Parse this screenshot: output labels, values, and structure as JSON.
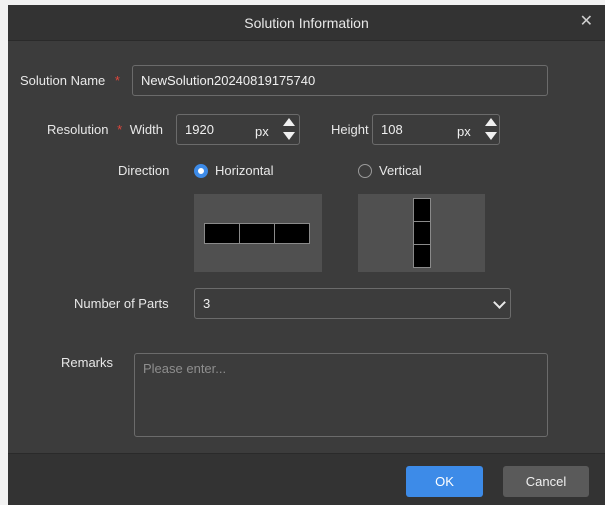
{
  "dialog": {
    "title": "Solution Information"
  },
  "solution_name": {
    "label": "Solution Name",
    "required_mark": "*",
    "value": "NewSolution20240819175740"
  },
  "resolution": {
    "label": "Resolution",
    "required_mark": "*",
    "width_label": "Width",
    "width_value": "1920",
    "width_unit": "px",
    "height_label": "Height",
    "height_value": "108",
    "height_unit": "px"
  },
  "direction": {
    "label": "Direction",
    "options": [
      {
        "label": "Horizontal",
        "selected": true
      },
      {
        "label": "Vertical",
        "selected": false
      }
    ]
  },
  "parts": {
    "label": "Number of Parts",
    "value": "3"
  },
  "remarks": {
    "label": "Remarks",
    "placeholder": "Please enter..."
  },
  "buttons": {
    "ok": "OK",
    "cancel": "Cancel"
  },
  "colors": {
    "accent": "#3d8be8",
    "required": "#e0463b",
    "background": "#3c3c3c"
  }
}
